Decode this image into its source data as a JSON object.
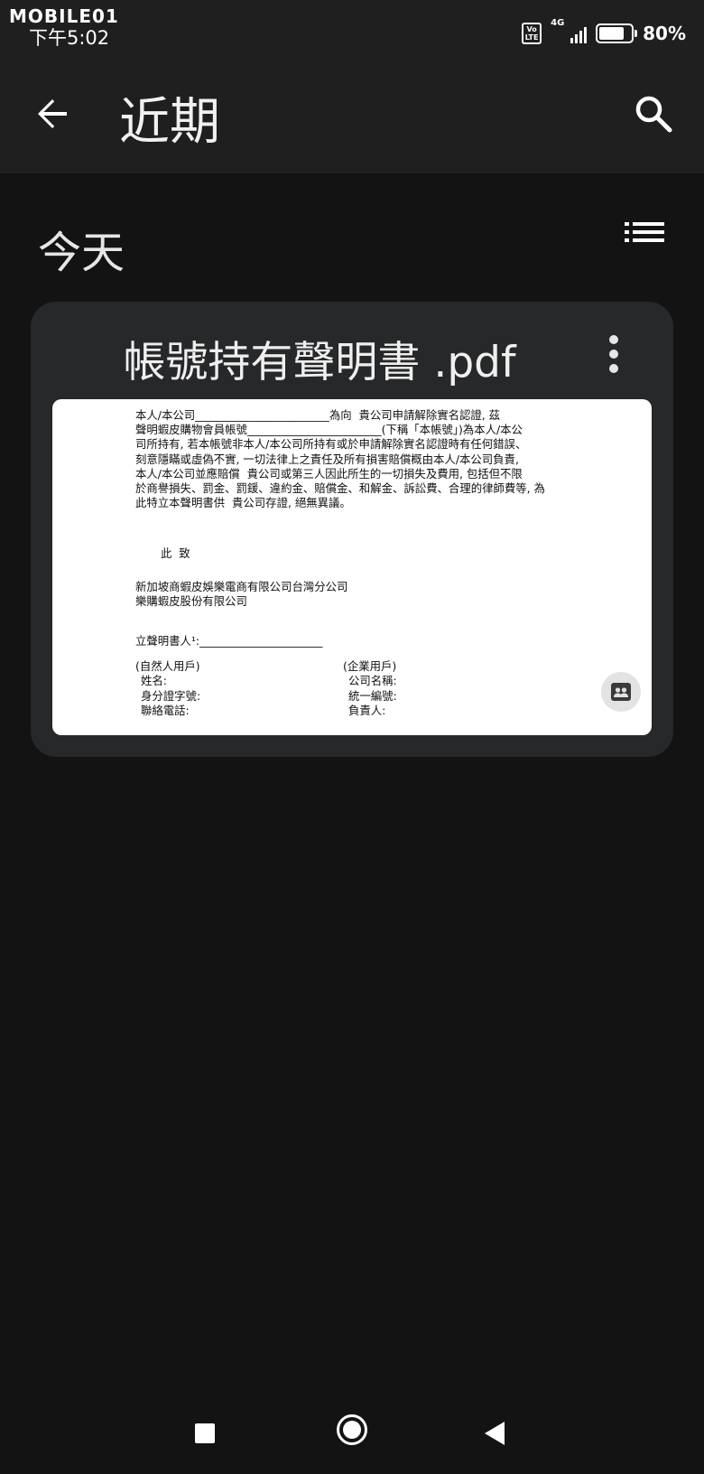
{
  "status_bar": {
    "watermark": "MOBILE01",
    "time": "下午5:02",
    "volte_label": "Vo\nLTE",
    "network": "4G",
    "battery_percent": "80%",
    "battery_level": 0.8
  },
  "app_bar": {
    "title": "近期",
    "back_icon": "arrow-left-icon",
    "search_icon": "search-icon"
  },
  "section": {
    "title": "今天",
    "view_icon": "list-view-icon"
  },
  "file_card": {
    "file_name": "帳號持有聲明書 .pdf",
    "more_icon": "more-vert-icon",
    "badge_icon": "shared-drive-icon",
    "preview": {
      "paragraph": [
        "本人/本公司________________________為向  貴公司申請解除實名認證, 茲",
        "聲明蝦皮購物會員帳號________________________(下稱「本帳號」)為本人/本公",
        "司所持有, 若本帳號非本人/本公司所持有或於申請解除實名認證時有任何錯誤、",
        "刻意隱瞞或虛偽不實, 一切法律上之責任及所有損害賠償概由本人/本公司負責,",
        "本人/本公司並應賠償  貴公司或第三人因此所生的一切損失及費用, 包括但不限",
        "於商譽損失、罰金、罰鍰、違約金、賠償金、和解金、訴訟費、合理的律師費等, 為",
        "此特立本聲明書供  貴公司存證, 絕無異議。"
      ],
      "closing": "此  致",
      "recipients": [
        "新加坡商蝦皮娛樂電商有限公司台灣分公司",
        "樂購蝦皮股份有限公司"
      ],
      "signer_line": "立聲明書人¹:______________________",
      "individual": {
        "header": "(自然人用戶)",
        "fields": [
          "姓名:",
          "身分證字號:",
          "聯絡電話:"
        ]
      },
      "company": {
        "header": "(企業用戶)",
        "fields": [
          "公司名稱:",
          "統一編號:",
          "負責人:"
        ]
      }
    }
  },
  "nav_bar": {
    "recents_icon": "square-recents-icon",
    "home_icon": "circle-home-icon",
    "back_icon": "triangle-back-icon"
  }
}
